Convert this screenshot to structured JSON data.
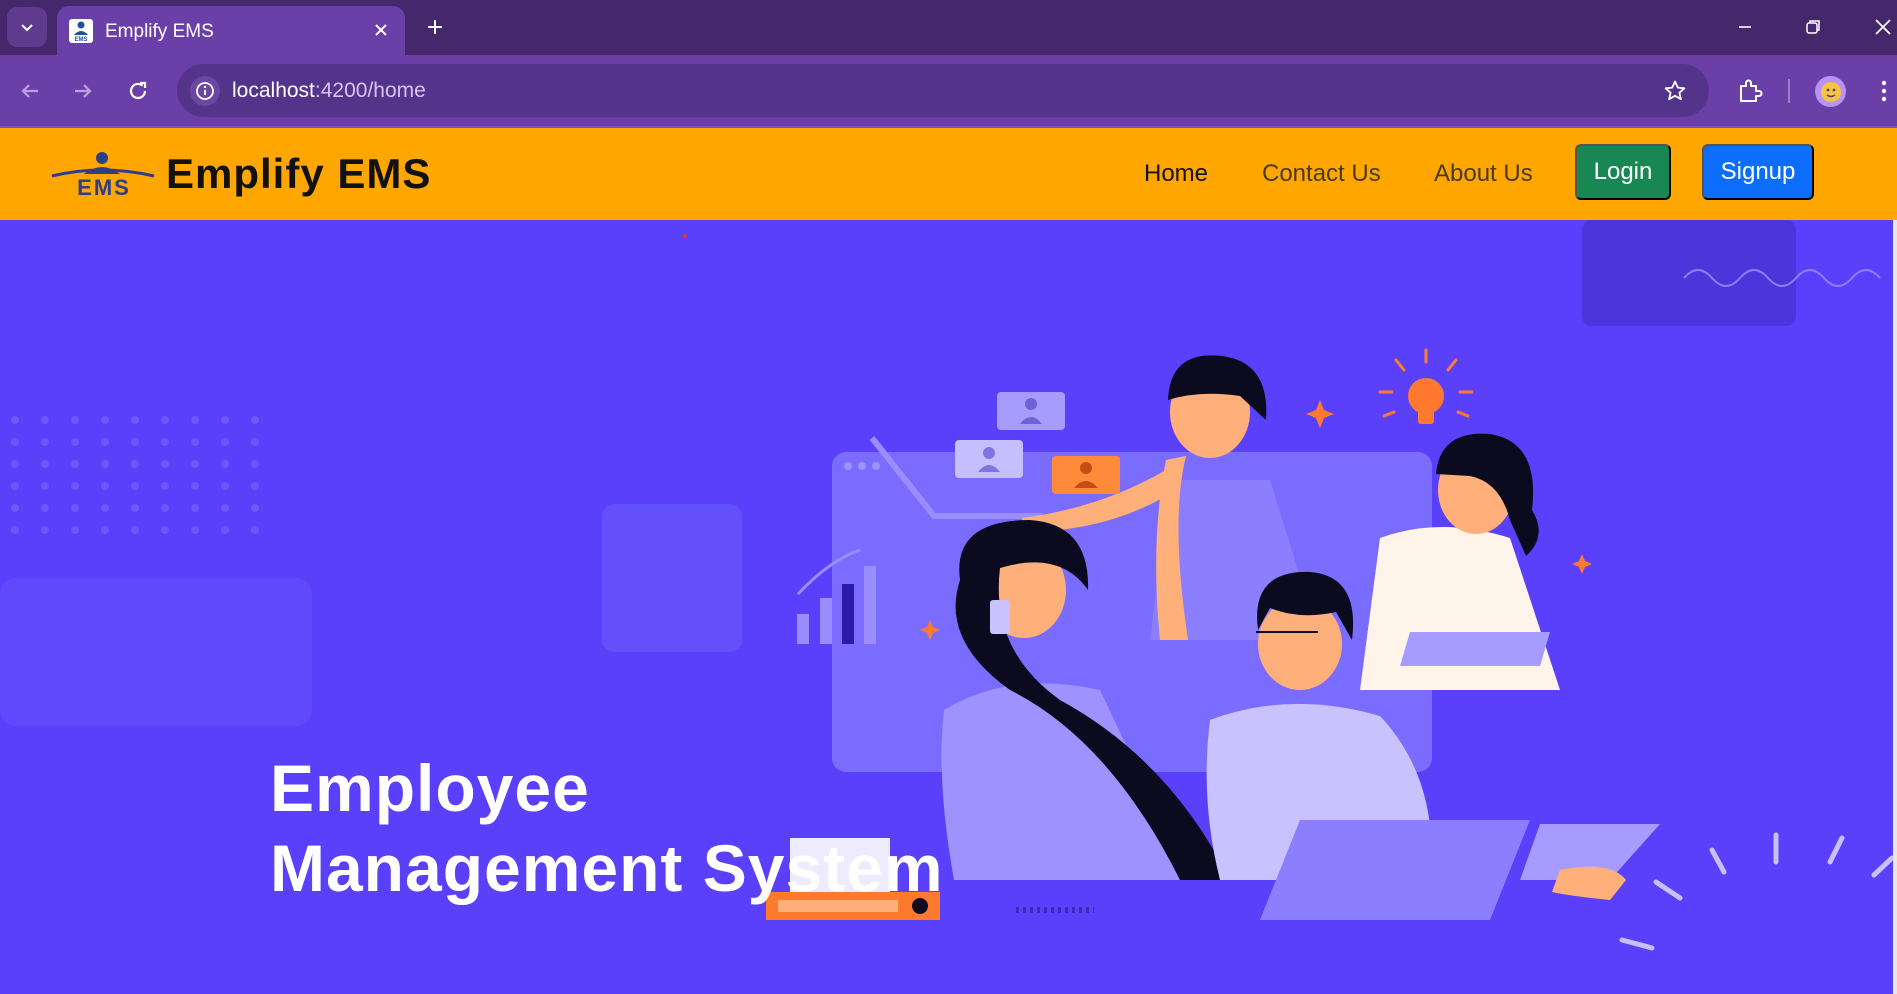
{
  "browser": {
    "tab_title": "Emplify EMS",
    "url_host": "localhost",
    "url_path": ":4200/home"
  },
  "navbar": {
    "brand": "Emplify EMS",
    "links": [
      "Home",
      "Contact Us",
      "About Us"
    ],
    "login_label": "Login",
    "signup_label": "Signup"
  },
  "hero": {
    "title_line1": "Employee",
    "title_line2": "Management System"
  },
  "colors": {
    "navbar": "#ffa600",
    "hero_background": "#5b40fb",
    "login_button": "#198754",
    "signup_button": "#0d6efd"
  }
}
